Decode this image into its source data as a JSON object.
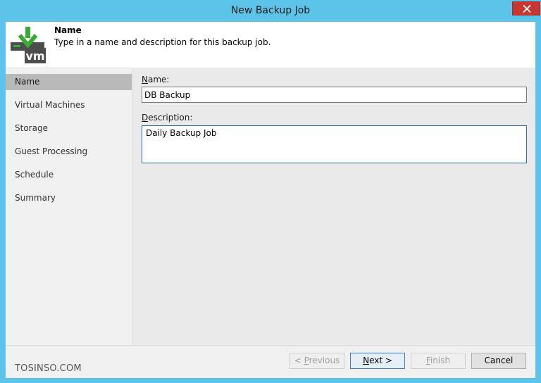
{
  "window": {
    "title": "New Backup Job"
  },
  "header": {
    "title": "Name",
    "description": "Type in a name and description for this backup job."
  },
  "sidebar": {
    "items": [
      {
        "label": "Name",
        "active": true
      },
      {
        "label": "Virtual Machines",
        "active": false
      },
      {
        "label": "Storage",
        "active": false
      },
      {
        "label": "Guest Processing",
        "active": false
      },
      {
        "label": "Schedule",
        "active": false
      },
      {
        "label": "Summary",
        "active": false
      }
    ]
  },
  "form": {
    "name_label_mn": "N",
    "name_label_rest": "ame:",
    "name_value": "DB Backup",
    "description_label_mn": "D",
    "description_label_rest": "escription:",
    "description_value": "Daily Backup Job"
  },
  "footer": {
    "watermark": "TOSINSO.COM",
    "previous_mn": "P",
    "previous_pre": "< ",
    "previous_rest": "revious",
    "next_mn": "N",
    "next_rest": "ext >",
    "finish_mn": "F",
    "finish_rest": "inish",
    "cancel_label": "Cancel"
  },
  "colors": {
    "frame": "#5bc4e8",
    "close_button": "#c7372f",
    "active_nav": "#b9b9b9",
    "focus_border": "#2a6bb5",
    "icon_green": "#3aa935",
    "icon_dark": "#4d4d4d"
  },
  "icons": {
    "close": "close-icon",
    "header": "vm-backup-icon"
  }
}
